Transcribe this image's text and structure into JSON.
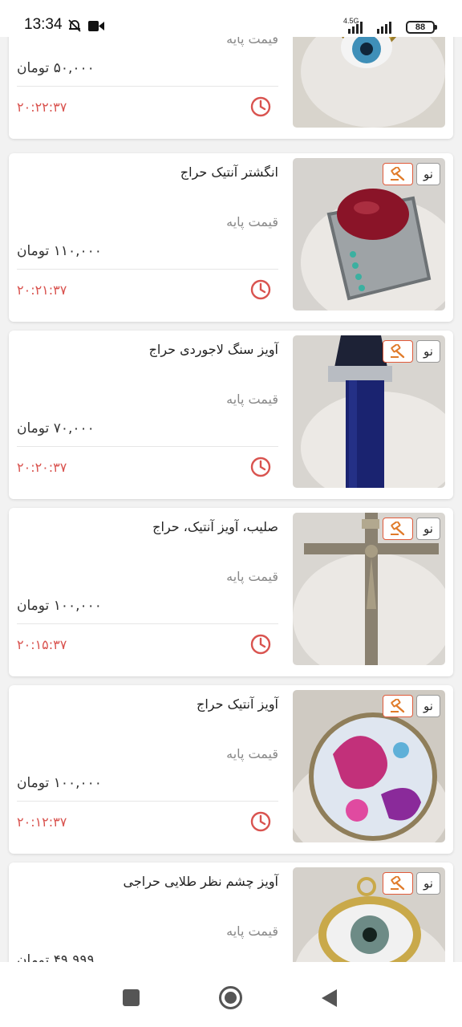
{
  "status_bar": {
    "time": "13:34",
    "network": "4.5G",
    "battery": "88",
    "icons": [
      "mute-icon",
      "video-icon",
      "signal-icon",
      "battery-icon"
    ]
  },
  "colors": {
    "accent": "#d9534f",
    "auction_badge": "#e05a3a",
    "background": "#f2f2f2"
  },
  "labels": {
    "new_badge": "نو",
    "base_price": "قیمت پایه"
  },
  "products": [
    {
      "title": "",
      "price": "۵۰,۰۰۰ تومان",
      "timer": "۲۰:۲۲:۳۷",
      "image": "gold-heart-evil-eye-ring"
    },
    {
      "title": "انگشتر آنتیک حراج",
      "price": "۱۱۰,۰۰۰ تومان",
      "timer": "۲۰:۲۱:۳۷",
      "image": "antique-ring-red-stone"
    },
    {
      "title": "آویز سنگ لاجوردی حراج",
      "price": "۷۰,۰۰۰ تومان",
      "timer": "۲۰:۲۰:۳۷",
      "image": "lapis-pendant"
    },
    {
      "title": "صلیب، آویز آنتیک، حراج",
      "price": "۱۰۰,۰۰۰ تومان",
      "timer": "۲۰:۱۵:۳۷",
      "image": "crucifix-pendant"
    },
    {
      "title": "آویز آنتیک حراج",
      "price": "۱۰۰,۰۰۰ تومان",
      "timer": "۲۰:۱۲:۳۷",
      "image": "paisley-pendant"
    },
    {
      "title": "آویز چشم نظر طلایی حراجی",
      "price": "۴۹,۹۹۹ تومان",
      "timer": "",
      "image": "gold-evil-eye-pendant"
    }
  ],
  "nav": {
    "buttons": [
      "recent-apps-button",
      "home-button",
      "back-button"
    ]
  }
}
